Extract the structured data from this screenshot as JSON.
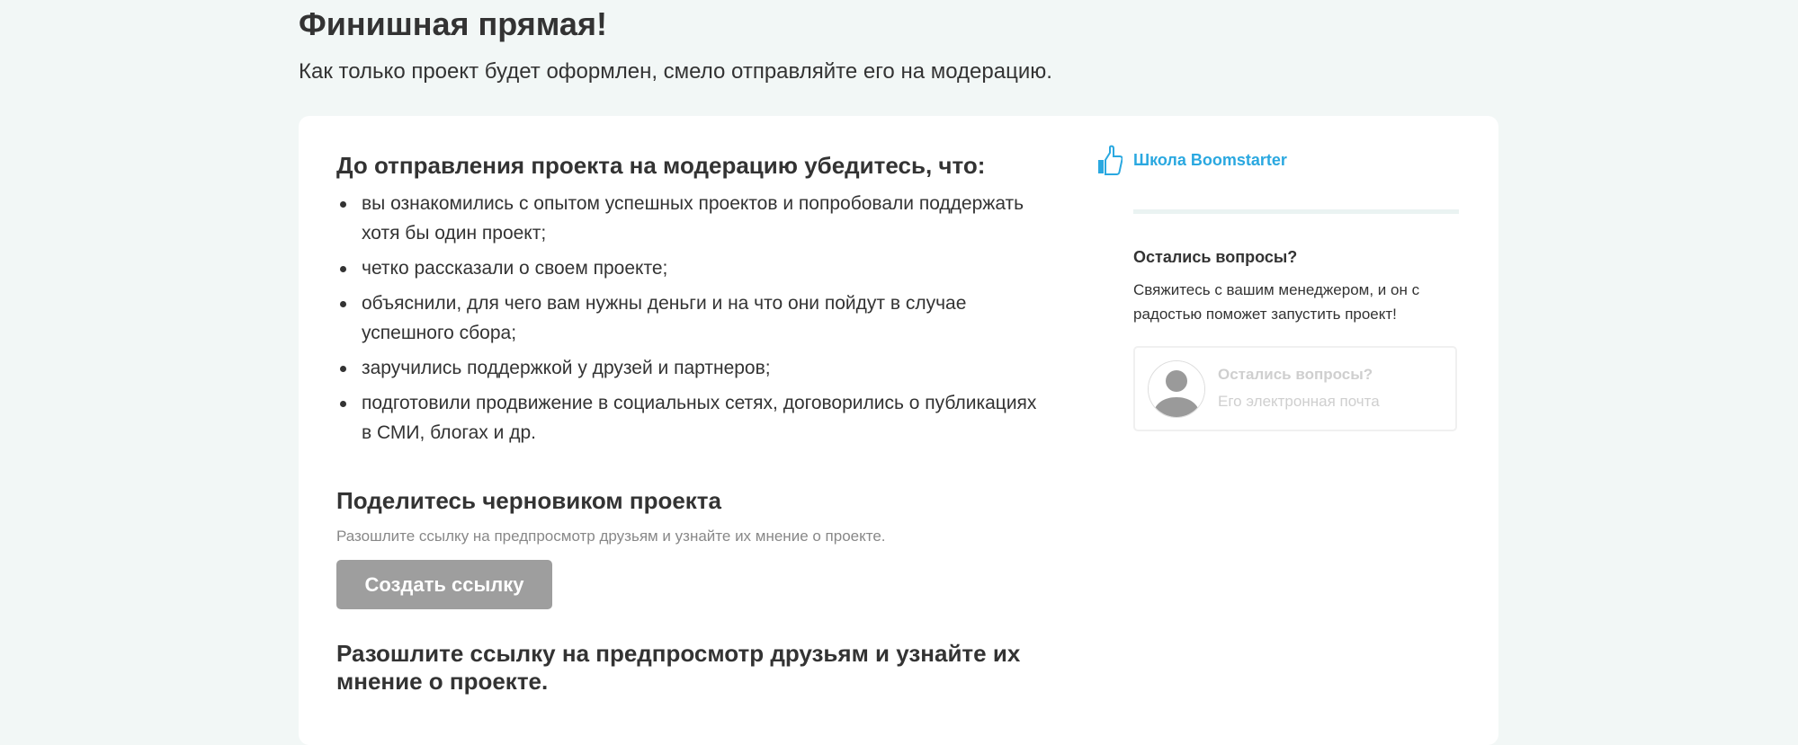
{
  "header": {
    "title": "Финишная прямая!",
    "subtitle": "Как только проект будет оформлен, смело отправляйте его на модерацию."
  },
  "checklist": {
    "title": "До отправления проекта на модерацию убедитесь, что:",
    "items": [
      "вы ознакомились с опытом успешных проектов и попробовали поддержать хотя бы один проект;",
      "четко рассказали о своем проекте;",
      "объяснили, для чего вам нужны деньги и на что они пойдут в случае успешного сбора;",
      "заручились поддержкой у друзей и партнеров;",
      "подготовили продвижение в социальных сетях, договорились о публикациях в СМИ, блогах и др."
    ]
  },
  "share": {
    "title": "Поделитесь черновиком проекта",
    "description": "Разошлите ссылку на предпросмотр друзьям и узнайте их мнение о проекте.",
    "button_label": "Создать ссылку",
    "bottom_heading": "Разошлите ссылку на предпросмотр друзьям и узнайте их мнение о проекте."
  },
  "sidebar": {
    "school_label": "Школа Boomstarter",
    "school_icon": "thumbs-up-icon",
    "questions_title": "Остались вопросы?",
    "questions_text": "Свяжитесь с вашим менеджером, и он с радостью поможет запустить проект!",
    "manager": {
      "title": "Остались вопросы?",
      "email_placeholder": "Его электронная почта",
      "avatar_icon": "person-avatar-icon"
    }
  },
  "colors": {
    "background": "#f2f7f6",
    "accent": "#2aa8e0",
    "button_disabled": "#9e9e9e",
    "text": "#333333",
    "muted": "#888888"
  }
}
